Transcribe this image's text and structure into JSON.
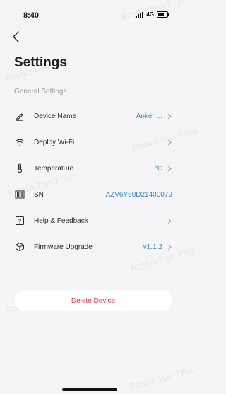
{
  "status_bar": {
    "time": "8:40",
    "network": "4G"
  },
  "header": {
    "title": "Settings"
  },
  "section": {
    "label": "General Settings"
  },
  "rows": [
    {
      "label": "Device Name",
      "value": "Anker ...",
      "icon": "pencil-icon"
    },
    {
      "label": "Deploy  Wi-Fi",
      "value": "",
      "icon": "wifi-icon"
    },
    {
      "label": "Temperature",
      "value": "°C",
      "icon": "thermometer-icon"
    },
    {
      "label": "SN",
      "value": "AZV6Y60D21400079",
      "icon": "barcode-icon"
    },
    {
      "label": "Help & Feedback",
      "value": "",
      "icon": "help-icon"
    },
    {
      "label": "Firmware Upgrade",
      "value": "v1.1.2",
      "icon": "box-icon"
    }
  ],
  "delete": {
    "label": "Delete Device"
  },
  "watermark": "Robbin Tian 7701",
  "colors": {
    "accent": "#3f86c9",
    "danger": "#d1464a",
    "background": "#f5f5f7"
  }
}
